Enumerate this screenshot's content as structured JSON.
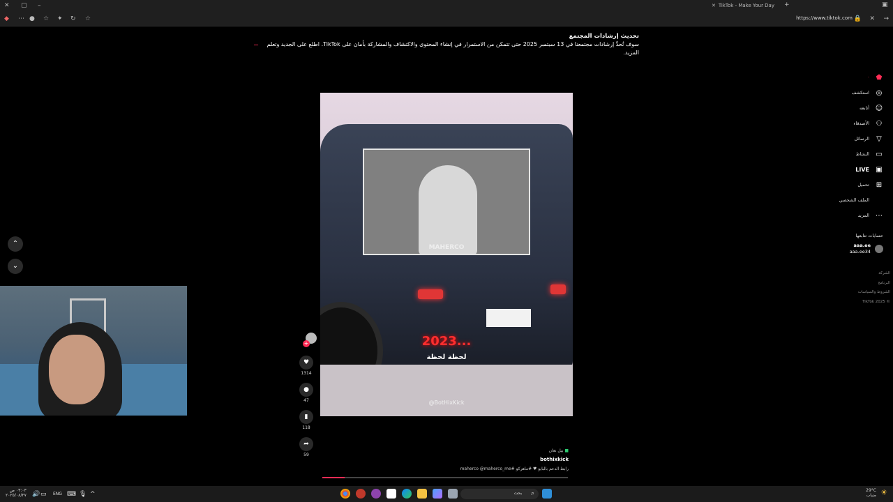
{
  "browser": {
    "tab_title": "TikTok - Make Your Day",
    "url": "https://www.tiktok.com"
  },
  "banner": {
    "title": "تحديث إرشادات المجتمع",
    "body": "سوف تُحدِّ إرشادات مجتمعنا في 13 سبتمبر 2025 حتى تتمكن من الاستمرار في إنشاء المحتوى والاكتشاف والمشاركة بأمان على TikTok. اطلع على الجديد وتعلم المزيد."
  },
  "sidebar": {
    "items": [
      {
        "label": "استكشف",
        "icon": "compass-icon"
      },
      {
        "label": "أتابعه",
        "icon": "person-plus-icon"
      },
      {
        "label": "الأصدقاء",
        "icon": "friends-icon"
      },
      {
        "label": "الرسائل",
        "icon": "send-icon"
      },
      {
        "label": "النشاط",
        "icon": "message-icon"
      },
      {
        "label": "LIVE",
        "icon": "live-tv-icon"
      },
      {
        "label": "تحميل",
        "icon": "upload-icon"
      },
      {
        "label": "الملف الشخصي",
        "icon": "profile-icon"
      },
      {
        "label": "المزيد",
        "icon": "more-icon"
      }
    ],
    "following_header": "حسابات تتابعها",
    "account": {
      "name": "aaa.ee",
      "handle": "aaa.ee34"
    }
  },
  "footer_links": [
    "الشركة",
    "البرنامج",
    "الشروط والسياسات",
    "© 2025 TikTok"
  ],
  "video": {
    "overlay_year": "2023...",
    "caption": "لحظة لحظة",
    "watermark": "@BotHixKick",
    "stream_logo": "MAHERCO",
    "likes": "1314",
    "comments": "47",
    "bookmarks": "118",
    "shares": "59",
    "progress": 0.09
  },
  "meta": {
    "music": "بيل نعان",
    "author": "bothixkick",
    "description": "رابط الدعم بالبايو ♥ #ماهركو #maherco @maherco_me"
  },
  "taskbar": {
    "search_placeholder": "بحث",
    "language": "ENG",
    "time": "٠٣:٠٣ ص",
    "date": "٢٠٢٥/٠٨/٢٧",
    "weather_temp": "29°C",
    "weather_desc": "ضباب"
  }
}
